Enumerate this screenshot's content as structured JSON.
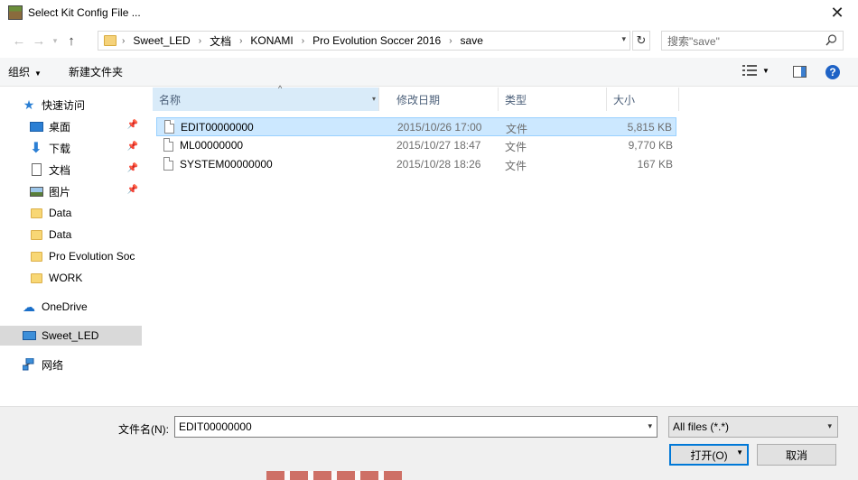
{
  "window": {
    "title": "Select Kit Config File ...",
    "close_glyph": "✕"
  },
  "nav": {
    "breadcrumbs": [
      "Sweet_LED",
      "文档",
      "KONAMI",
      "Pro Evolution Soccer 2016",
      "save"
    ],
    "search_placeholder": "搜索\"save\""
  },
  "toolbar": {
    "organize_label": "组织",
    "new_folder_label": "新建文件夹"
  },
  "sidebar": {
    "quick_access": "快速访问",
    "items": [
      {
        "label": "桌面",
        "pinned": true
      },
      {
        "label": "下载",
        "pinned": true
      },
      {
        "label": "文档",
        "pinned": true
      },
      {
        "label": "图片",
        "pinned": true
      },
      {
        "label": "Data",
        "pinned": false
      },
      {
        "label": "Data",
        "pinned": false
      },
      {
        "label": "Pro Evolution Soc",
        "pinned": false
      },
      {
        "label": "WORK",
        "pinned": false
      }
    ],
    "onedrive": "OneDrive",
    "this_pc": "Sweet_LED",
    "network": "网络"
  },
  "filelist": {
    "columns": [
      "名称",
      "修改日期",
      "类型",
      "大小"
    ],
    "rows": [
      {
        "name": "EDIT00000000",
        "date": "2015/10/26 17:00",
        "type": "文件",
        "size": "5,815 KB",
        "selected": true
      },
      {
        "name": "ML00000000",
        "date": "2015/10/27 18:47",
        "type": "文件",
        "size": "9,770 KB",
        "selected": false
      },
      {
        "name": "SYSTEM00000000",
        "date": "2015/10/28 18:26",
        "type": "文件",
        "size": "167 KB",
        "selected": false
      }
    ]
  },
  "bottom": {
    "filename_label": "文件名(N):",
    "filename_value": "EDIT00000000",
    "filetype_value": "All files (*.*)",
    "open_label": "打开(O)",
    "cancel_label": "取消"
  },
  "colors": {
    "accent": "#0078d7",
    "selection": "#cce8ff",
    "toolbar_bg": "#f5f6f7",
    "bottom_bg": "#f0f0f0"
  }
}
